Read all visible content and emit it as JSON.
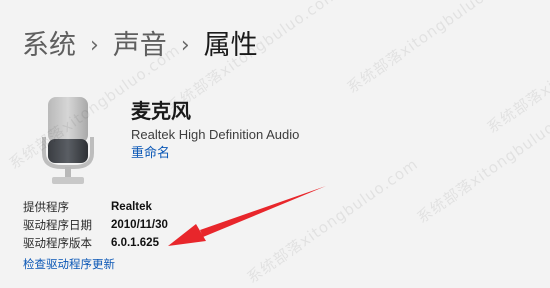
{
  "breadcrumb": {
    "items": [
      "系统",
      "声音",
      "属性"
    ],
    "separator": "›"
  },
  "device": {
    "icon": "microphone-icon",
    "name": "麦克风",
    "description": "Realtek High Definition Audio",
    "rename_label": "重命名"
  },
  "properties": [
    {
      "label": "提供程序",
      "value": "Realtek"
    },
    {
      "label": "驱动程序日期",
      "value": "2010/11/30"
    },
    {
      "label": "驱动程序版本",
      "value": "6.0.1.625"
    }
  ],
  "update_driver_label": "检查驱动程序更新",
  "watermark_text": "系统部落xitongbuluo.com",
  "colors": {
    "background": "#f3f3f3",
    "link": "#0a57b6",
    "annotation_arrow": "#e8262b"
  }
}
